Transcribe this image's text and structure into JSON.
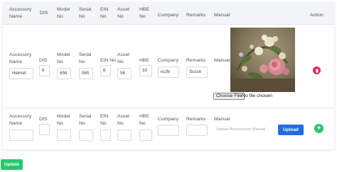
{
  "headers": {
    "accessory_name": "Accessory Name",
    "dis": "DIS",
    "model_no": "Model No",
    "serial_no": "Serial No",
    "ein_no": "EIN No",
    "asset_no": "Asset No",
    "hbe_no": "HBE No",
    "company": "Company",
    "remarks": "Remarks",
    "manual": "Manual",
    "action": "Action"
  },
  "row1": {
    "labels": {
      "accessory_name": "Accessory Name",
      "dis": "DIS",
      "model_no": "Model No",
      "serial_no": "Serial No",
      "ein_no": "EIN No",
      "asset_no": "Asset No",
      "hbe": "HBE",
      "company": "Company",
      "remarks": "Remarks",
      "manual": "Manual"
    },
    "values": {
      "accessory_name": "Helmet",
      "dis": "6",
      "model_no": "656",
      "serial_no": "565",
      "ein_no": "6",
      "asset_no": "56",
      "hbe": "33",
      "company": "eLife",
      "remarks": "Succe"
    },
    "file_button": "Choose File",
    "file_status": "No file chosen",
    "delete_icon": "trash-icon",
    "delete_color": "#e0245e"
  },
  "row2": {
    "labels": {
      "accessory_name": "Accessory Name",
      "dis": "DIS",
      "model_no": "Model No",
      "serial_no": "Serial No",
      "ein_no": "EIN No",
      "asset_no": "Asset No",
      "hbe_no": "HBE No",
      "company": "Company",
      "remarks": "Remarks",
      "manual": "Manual"
    },
    "manual_placeholder": "Upload Accessories Manual",
    "upload_label": "Upload",
    "add_label": "+",
    "upload_color": "#1e6fe0",
    "add_color": "#28c76f"
  },
  "footer": {
    "update_label": "Update",
    "update_color": "#28c76f"
  }
}
